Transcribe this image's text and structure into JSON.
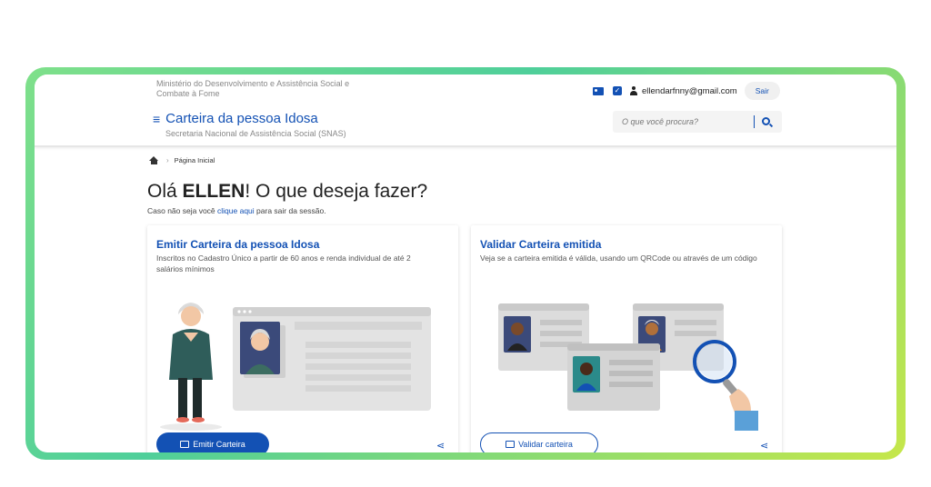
{
  "header": {
    "ministry": "Ministério do Desenvolvimento e Assistência Social e Combate à Fome",
    "site_title": "Carteira da pessoa Idosa",
    "secretaria": "Secretaria Nacional de Assistência Social (SNAS)",
    "email": "ellendarfnny@gmail.com",
    "logout_label": "Sair",
    "search_placeholder": "O que você procura?"
  },
  "breadcrumb": {
    "home_label": "Página Inicial"
  },
  "greeting": {
    "prefix": "Olá ",
    "name": "ELLEN",
    "suffix": "! O que deseja fazer?",
    "not_you_prefix": "Caso não seja você ",
    "not_you_link": "clique aqui",
    "not_you_suffix": " para sair da sessão."
  },
  "cards": [
    {
      "title": "Emitir Carteira da pessoa Idosa",
      "description": "Inscritos no Cadastro Único a partir de 60 anos e renda individual de até 2 salários mínimos",
      "button_label": "Emitir Carteira"
    },
    {
      "title": "Validar Carteira emitida",
      "description": "Veja se a carteira emitida é válida, usando um QRCode ou através de um código",
      "button_label": "Validar carteira"
    }
  ],
  "colors": {
    "primary": "#1351b4",
    "frame_gradient_start": "#7fe08a",
    "frame_gradient_end": "#c6e74a"
  }
}
